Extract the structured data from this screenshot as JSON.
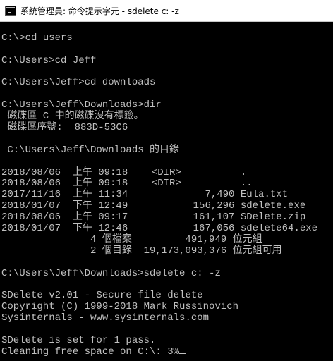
{
  "window": {
    "title": "系統管理員: 命令提示字元 - sdelete  c: -z",
    "icon": "cmd-console-icon"
  },
  "console": {
    "cursor": "underscore",
    "lines": [
      "",
      "C:\\>cd users",
      "",
      "C:\\Users>cd Jeff",
      "",
      "C:\\Users\\Jeff>cd downloads",
      "",
      "C:\\Users\\Jeff\\Downloads>dir",
      " 磁碟區 C 中的磁碟沒有標籤。",
      " 磁碟區序號:  883D-53C6",
      "",
      " C:\\Users\\Jeff\\Downloads 的目錄",
      "",
      "2018/08/06  上午 09:18    <DIR>          .",
      "2018/08/06  上午 09:18    <DIR>          ..",
      "2017/11/16  上午 11:34             7,490 Eula.txt",
      "2018/01/07  下午 12:49           156,296 sdelete.exe",
      "2018/08/06  上午 09:17           161,107 SDelete.zip",
      "2018/01/07  下午 12:46           167,056 sdelete64.exe",
      "               4 個檔案         491,949 位元組",
      "               2 個目錄  19,173,093,376 位元組可用",
      "",
      "C:\\Users\\Jeff\\Downloads>sdelete c: -z",
      "",
      "SDelete v2.01 - Secure file delete",
      "Copyright (C) 1999-2018 Mark Russinovich",
      "Sysinternals - www.sysinternals.com",
      "",
      "SDelete is set for 1 pass.",
      "Cleaning free space on C:\\: 3%"
    ]
  },
  "colors": {
    "background": "#000000",
    "foreground": "#c0c0c0",
    "titlebar": "#ffffff"
  }
}
